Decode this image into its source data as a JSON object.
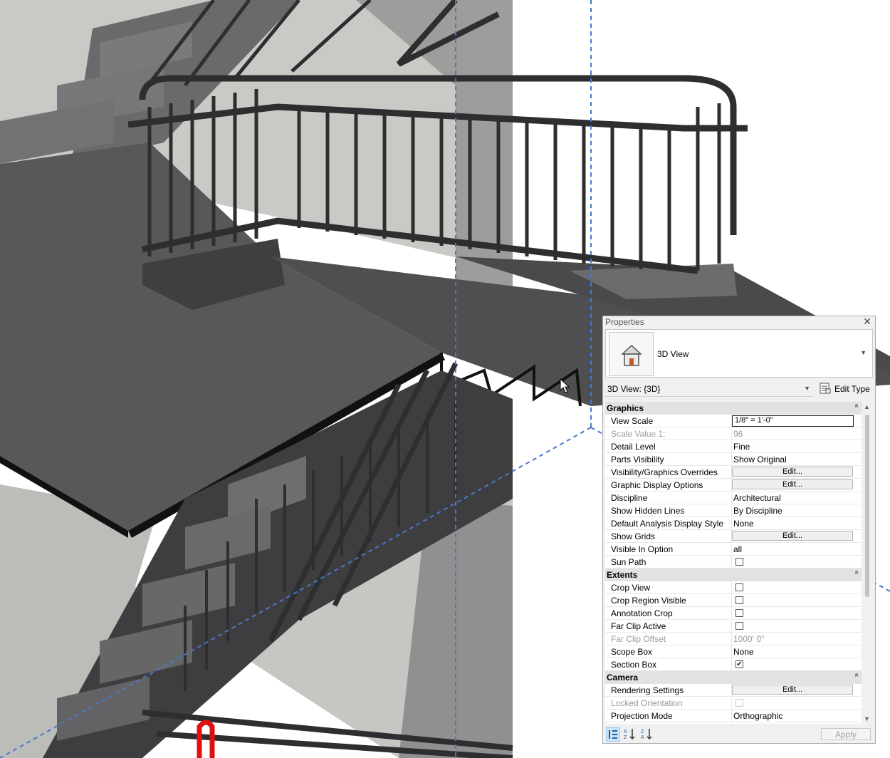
{
  "properties": {
    "title": "Properties",
    "type_name": "3D View",
    "instance_label": "3D View: {3D}",
    "edit_type_label": "Edit Type",
    "apply_label": "Apply",
    "sections": [
      {
        "label": "Graphics",
        "rows": [
          {
            "name": "View Scale",
            "value": "1/8\" = 1'-0\"",
            "kind": "input"
          },
          {
            "name": "Scale Value    1:",
            "value": "96",
            "kind": "text",
            "disabled": true
          },
          {
            "name": "Detail Level",
            "value": "Fine",
            "kind": "text"
          },
          {
            "name": "Parts Visibility",
            "value": "Show Original",
            "kind": "text"
          },
          {
            "name": "Visibility/Graphics Overrides",
            "value": "Edit...",
            "kind": "button"
          },
          {
            "name": "Graphic Display Options",
            "value": "Edit...",
            "kind": "button"
          },
          {
            "name": "Discipline",
            "value": "Architectural",
            "kind": "text"
          },
          {
            "name": "Show Hidden Lines",
            "value": "By Discipline",
            "kind": "text"
          },
          {
            "name": "Default Analysis Display Style",
            "value": "None",
            "kind": "text"
          },
          {
            "name": "Show Grids",
            "value": "Edit...",
            "kind": "button"
          },
          {
            "name": "Visible In Option",
            "value": "all",
            "kind": "text"
          },
          {
            "name": "Sun Path",
            "value": "",
            "kind": "checkbox",
            "checked": false
          }
        ]
      },
      {
        "label": "Extents",
        "rows": [
          {
            "name": "Crop View",
            "value": "",
            "kind": "checkbox",
            "checked": false
          },
          {
            "name": "Crop Region Visible",
            "value": "",
            "kind": "checkbox",
            "checked": false
          },
          {
            "name": "Annotation Crop",
            "value": "",
            "kind": "checkbox",
            "checked": false
          },
          {
            "name": "Far Clip Active",
            "value": "",
            "kind": "checkbox",
            "checked": false
          },
          {
            "name": "Far Clip Offset",
            "value": "1000'  0\"",
            "kind": "text",
            "disabled": true
          },
          {
            "name": "Scope Box",
            "value": "None",
            "kind": "text"
          },
          {
            "name": "Section Box",
            "value": "",
            "kind": "checkbox",
            "checked": true
          }
        ]
      },
      {
        "label": "Camera",
        "rows": [
          {
            "name": "Rendering Settings",
            "value": "Edit...",
            "kind": "button"
          },
          {
            "name": "Locked Orientation",
            "value": "",
            "kind": "checkbox",
            "checked": false,
            "disabled": true
          },
          {
            "name": "Projection Mode",
            "value": "Orthographic",
            "kind": "text"
          }
        ]
      }
    ],
    "collapse_glyph": "»",
    "check_glyph": "✔",
    "dropdown_glyph": "▼",
    "close_glyph": "✕"
  },
  "colors": {
    "stair_dark": "#4a4a4c",
    "stair_mid": "#5e5e60",
    "wall": "#9a9a98",
    "section_box": "#4a78c8",
    "highlight": "#e01010"
  }
}
